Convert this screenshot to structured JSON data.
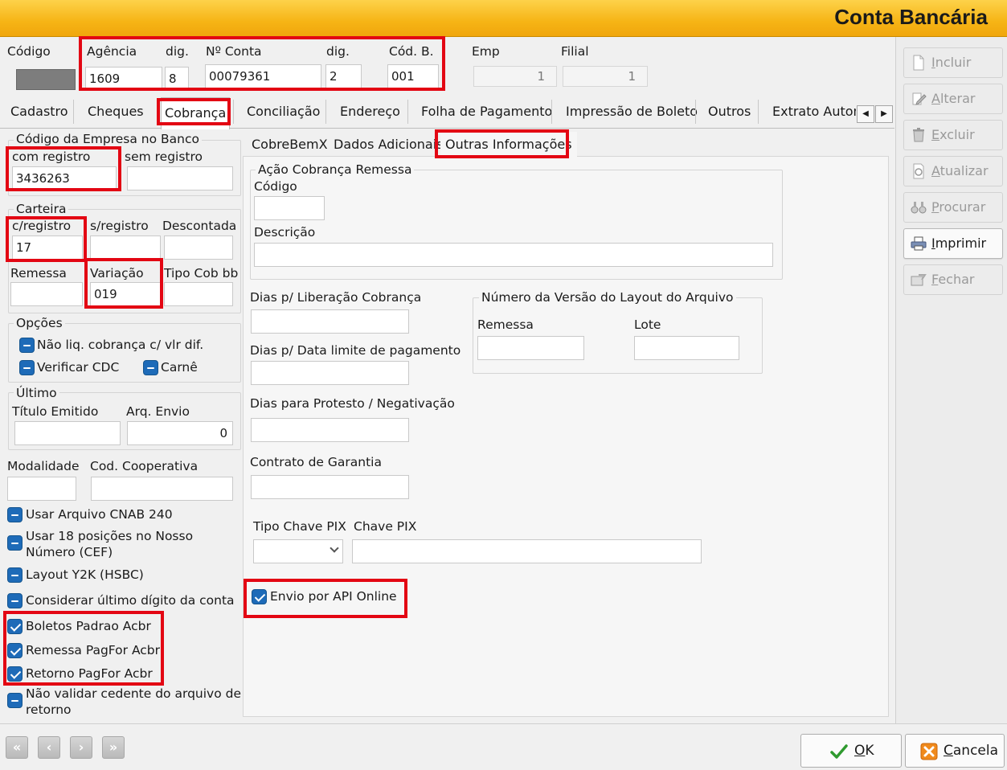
{
  "window": {
    "title": "Conta Bancária"
  },
  "header": {
    "codigo_label": "Código",
    "agencia_label": "Agência",
    "agencia_value": "1609",
    "dig1_label": "dig.",
    "dig1_value": "8",
    "conta_label": "Nº Conta",
    "conta_value": "00079361",
    "dig2_label": "dig.",
    "dig2_value": "2",
    "codb_label": "Cód. B.",
    "codb_value": "001",
    "emp_label": "Emp",
    "emp_value": "1",
    "filial_label": "Filial",
    "filial_value": "1"
  },
  "tabs": [
    "Cadastro",
    "Cheques",
    "Cobrança",
    "Conciliação",
    "Endereço",
    "Folha de Pagamento",
    "Impressão de Boleto",
    "Outros",
    "Extrato Autom"
  ],
  "left": {
    "cod_empresa_group": "Código da Empresa no Banco",
    "com_registro_label": "com registro",
    "com_registro_value": "3436263",
    "sem_registro_label": "sem registro",
    "sem_registro_value": "",
    "carteira_group": "Carteira",
    "c_registro_label": "c/registro",
    "c_registro_value": "17",
    "s_registro_label": "s/registro",
    "descontada_label": "Descontada",
    "remessa_label": "Remessa",
    "variacao_label": "Variação",
    "variacao_value": "019",
    "tipo_cob_label": "Tipo Cob bb",
    "opcoes_group": "Opções",
    "opt_nao_liq": "Não liq. cobrança c/ vlr dif.",
    "opt_verificar_cdc": "Verificar CDC",
    "opt_carne": "Carnê",
    "ultimo_group": "Último",
    "titulo_emitido_label": "Título Emitido",
    "arq_envio_label": "Arq. Envio",
    "arq_envio_value": "0",
    "modalidade_label": "Modalidade",
    "cod_cooperativa_label": "Cod. Cooperativa",
    "chk_cnab240": "Usar Arquivo CNAB 240",
    "chk_18pos_line1": "Usar 18 posições no Nosso",
    "chk_18pos_line2": "Número (CEF)",
    "chk_y2k": "Layout Y2K (HSBC)",
    "chk_ultimo_digito": "Considerar último dígito da conta",
    "chk_boletos_padrao": "Boletos Padrao Acbr",
    "chk_remessa_pagfor": "Remessa PagFor Acbr",
    "chk_retorno_pagfor": "Retorno PagFor Acbr",
    "chk_nao_validar_line1": "Não validar cedente do arquivo de",
    "chk_nao_validar_line2": "retorno"
  },
  "subtabs": [
    "CobreBemX",
    "Dados Adicionais",
    "Outras Informações"
  ],
  "outras": {
    "acao_group": "Ação Cobrança Remessa",
    "codigo_label": "Código",
    "descricao_label": "Descrição",
    "dias_liberacao_label": "Dias p/ Liberação Cobrança",
    "dias_data_limite_label": "Dias p/ Data limite de pagamento",
    "dias_protesto_label": "Dias para Protesto / Negativação",
    "contrato_garantia_label": "Contrato de Garantia",
    "tipo_chave_pix_label": "Tipo Chave PIX",
    "chave_pix_label": "Chave PIX",
    "versao_group": "Número da Versão do Layout do Arquivo",
    "versao_remessa_label": "Remessa",
    "versao_lote_label": "Lote",
    "envio_api_label": "Envio por API Online"
  },
  "toolbar": {
    "incluir_first": "I",
    "incluir_rest": "ncluir",
    "alterar_first": "A",
    "alterar_rest": "lterar",
    "excluir_first": "E",
    "excluir_rest": "xcluir",
    "atualizar_first": "A",
    "atualizar_rest": "tualizar",
    "procurar_first": "P",
    "procurar_rest": "rocurar",
    "imprimir_first": "I",
    "imprimir_rest": "mprimir",
    "fechar_first": "F",
    "fechar_rest": "echar"
  },
  "footer": {
    "ok_first": "O",
    "ok_rest": "K",
    "cancela_first": "C",
    "cancela_rest": "ancela"
  },
  "colors": {
    "accent": "#f6b415",
    "highlight": "#e30613",
    "checkbox": "#1e6bb8"
  }
}
